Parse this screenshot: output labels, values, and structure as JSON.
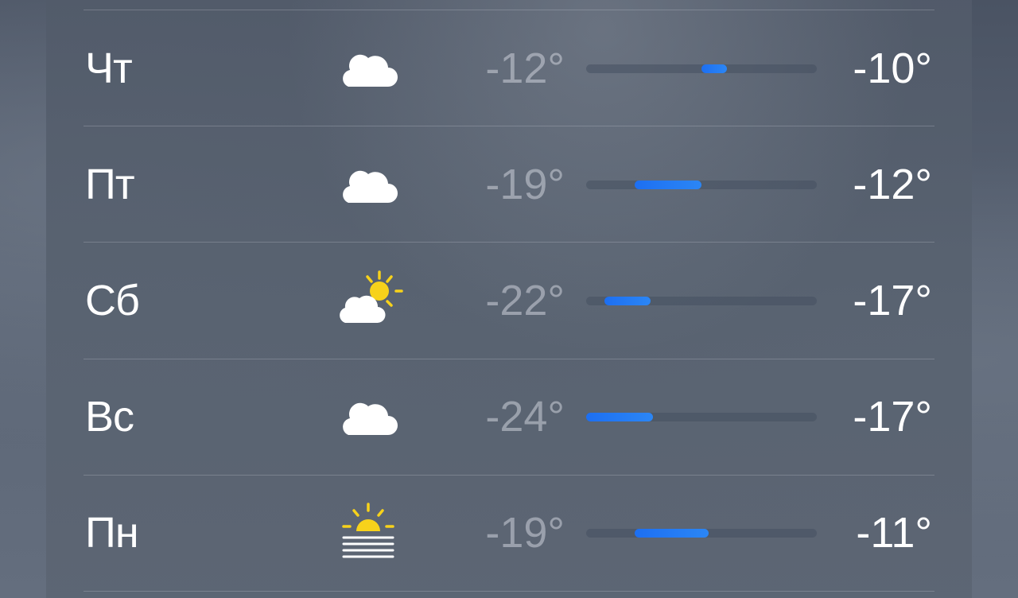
{
  "forecast": {
    "days": [
      {
        "day": "Чт",
        "icon": "cloud-icon",
        "low": "-12°",
        "high": "-10°",
        "bar": {
          "start": 0.5,
          "end": 0.61
        }
      },
      {
        "day": "Пт",
        "icon": "cloud-icon",
        "low": "-19°",
        "high": "-12°",
        "bar": {
          "start": 0.21,
          "end": 0.5
        }
      },
      {
        "day": "Сб",
        "icon": "partly-sunny-icon",
        "low": "-22°",
        "high": "-17°",
        "bar": {
          "start": 0.08,
          "end": 0.28
        }
      },
      {
        "day": "Вс",
        "icon": "cloud-icon",
        "low": "-24°",
        "high": "-17°",
        "bar": {
          "start": 0.0,
          "end": 0.29
        }
      },
      {
        "day": "Пн",
        "icon": "fog-sun-icon",
        "low": "-19°",
        "high": "-11°",
        "bar": {
          "start": 0.21,
          "end": 0.53
        }
      }
    ]
  },
  "colors": {
    "bar_fill": "#1d6ff2",
    "sun": "#f7d21b",
    "text_primary": "#ffffff"
  }
}
